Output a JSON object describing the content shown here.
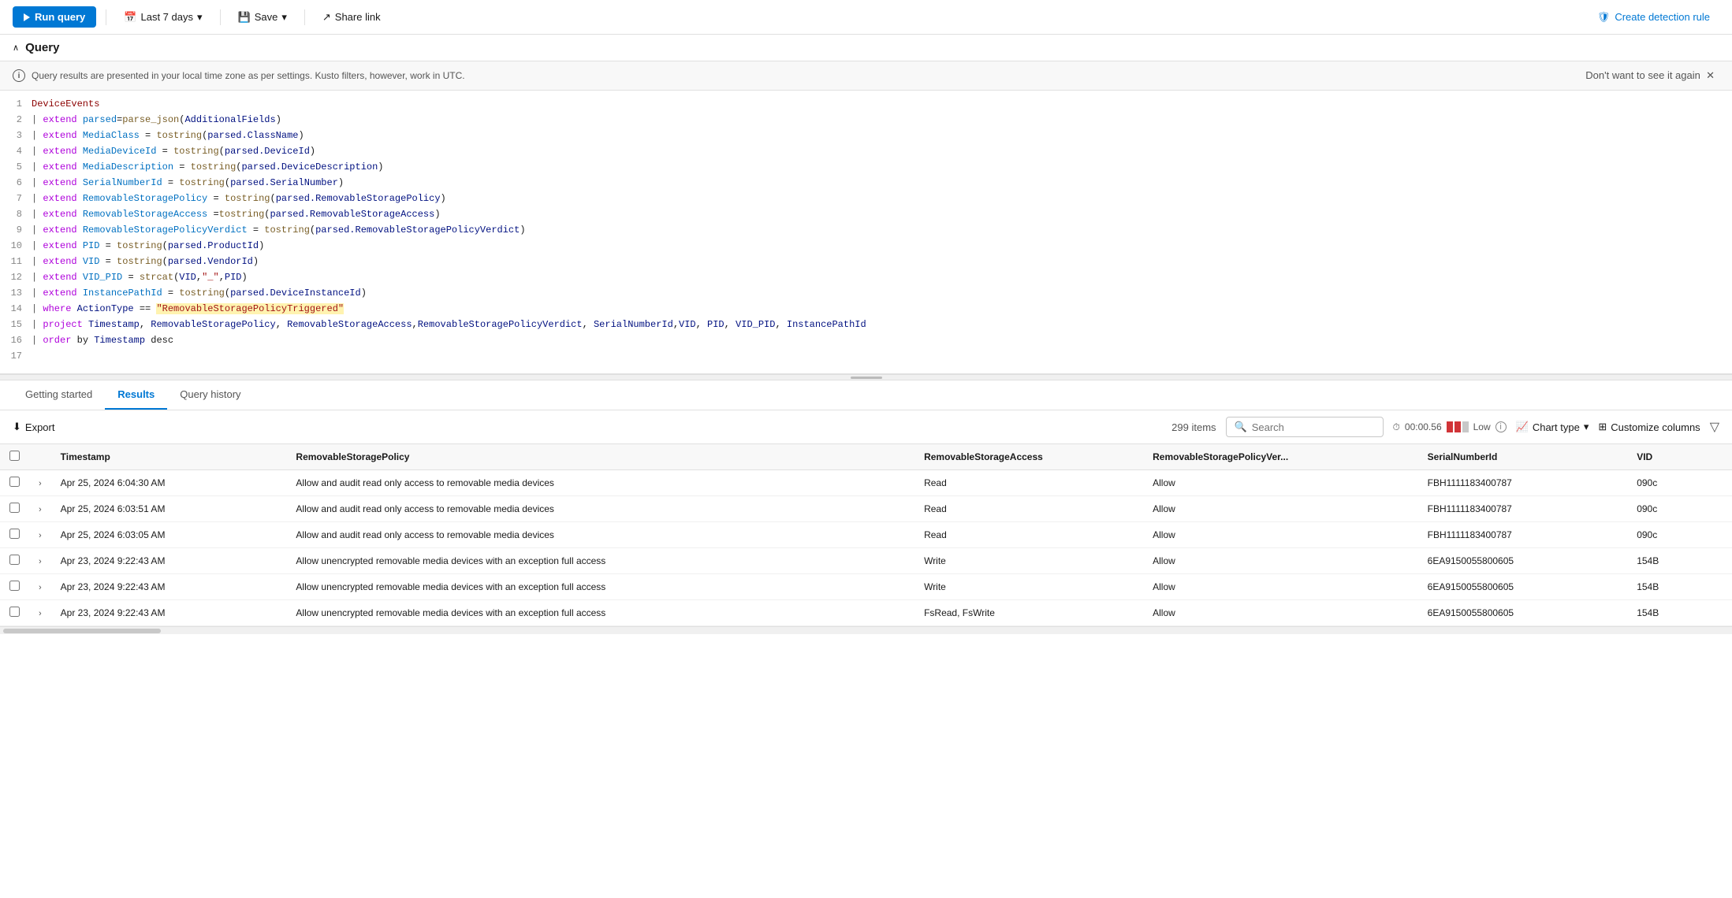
{
  "toolbar": {
    "run_label": "Run query",
    "time_range": "Last 7 days",
    "save_label": "Save",
    "share_label": "Share link",
    "create_rule_label": "Create detection rule"
  },
  "section": {
    "title": "Query"
  },
  "info_banner": {
    "message": "Query results are presented in your local time zone as per settings. Kusto filters, however, work in UTC.",
    "dismiss": "Don't want to see it again"
  },
  "code_lines": [
    {
      "num": "1",
      "content": "DeviceEvents"
    },
    {
      "num": "2",
      "content": "| extend parsed=parse_json(AdditionalFields)"
    },
    {
      "num": "3",
      "content": "| extend MediaClass = tostring(parsed.ClassName)"
    },
    {
      "num": "4",
      "content": "| extend MediaDeviceId = tostring(parsed.DeviceId)"
    },
    {
      "num": "5",
      "content": "| extend MediaDescription = tostring(parsed.DeviceDescription)"
    },
    {
      "num": "6",
      "content": "| extend SerialNumberId = tostring(parsed.SerialNumber)"
    },
    {
      "num": "7",
      "content": "| extend RemovableStoragePolicy = tostring(parsed.RemovableStoragePolicy)"
    },
    {
      "num": "8",
      "content": "| extend RemovableStorageAccess =tostring(parsed.RemovableStorageAccess)"
    },
    {
      "num": "9",
      "content": "| extend RemovableStoragePolicyVerdict = tostring(parsed.RemovableStoragePolicyVerdict)"
    },
    {
      "num": "10",
      "content": "| extend PID = tostring(parsed.ProductId)"
    },
    {
      "num": "11",
      "content": "| extend VID = tostring(parsed.VendorId)"
    },
    {
      "num": "12",
      "content": "| extend VID_PID = strcat(VID,\"_\",PID)"
    },
    {
      "num": "13",
      "content": "| extend InstancePathId = tostring(parsed.DeviceInstanceId)"
    },
    {
      "num": "14",
      "content": "| where ActionType == \"RemovableStoragePolicyTriggered\""
    },
    {
      "num": "15",
      "content": "| project Timestamp, RemovableStoragePolicy, RemovableStorageAccess,RemovableStoragePolicyVerdict, SerialNumberId,VID, PID, VID_PID, InstancePathId"
    },
    {
      "num": "16",
      "content": "| order by Timestamp desc"
    },
    {
      "num": "17",
      "content": ""
    }
  ],
  "tabs": {
    "getting_started": "Getting started",
    "results": "Results",
    "query_history": "Query history"
  },
  "results_toolbar": {
    "export": "Export",
    "items_count": "299 items",
    "search_placeholder": "Search",
    "timing": "00:00.56",
    "low_label": "Low",
    "chart_type": "Chart type",
    "customize": "Customize columns"
  },
  "table": {
    "columns": [
      "Timestamp",
      "RemovableStoragePolicy",
      "RemovableStorageAccess",
      "RemovableStoragePolicyVer...",
      "SerialNumberId",
      "VID"
    ],
    "rows": [
      {
        "timestamp": "Apr 25, 2024 6:04:30 AM",
        "policy": "Allow and audit read only access to removable media devices",
        "access": "Read",
        "verdict": "Allow",
        "serial": "FBH1111183400787",
        "vid": "090c"
      },
      {
        "timestamp": "Apr 25, 2024 6:03:51 AM",
        "policy": "Allow and audit read only access to removable media devices",
        "access": "Read",
        "verdict": "Allow",
        "serial": "FBH1111183400787",
        "vid": "090c"
      },
      {
        "timestamp": "Apr 25, 2024 6:03:05 AM",
        "policy": "Allow and audit read only access to removable media devices",
        "access": "Read",
        "verdict": "Allow",
        "serial": "FBH1111183400787",
        "vid": "090c"
      },
      {
        "timestamp": "Apr 23, 2024 9:22:43 AM",
        "policy": "Allow unencrypted removable media devices with an exception full access",
        "access": "Write",
        "verdict": "Allow",
        "serial": "6EA9150055800605",
        "vid": "154B"
      },
      {
        "timestamp": "Apr 23, 2024 9:22:43 AM",
        "policy": "Allow unencrypted removable media devices with an exception full access",
        "access": "Write",
        "verdict": "Allow",
        "serial": "6EA9150055800605",
        "vid": "154B"
      },
      {
        "timestamp": "Apr 23, 2024 9:22:43 AM",
        "policy": "Allow unencrypted removable media devices with an exception full access",
        "access": "FsRead, FsWrite",
        "verdict": "Allow",
        "serial": "6EA9150055800605",
        "vid": "154B"
      }
    ]
  }
}
